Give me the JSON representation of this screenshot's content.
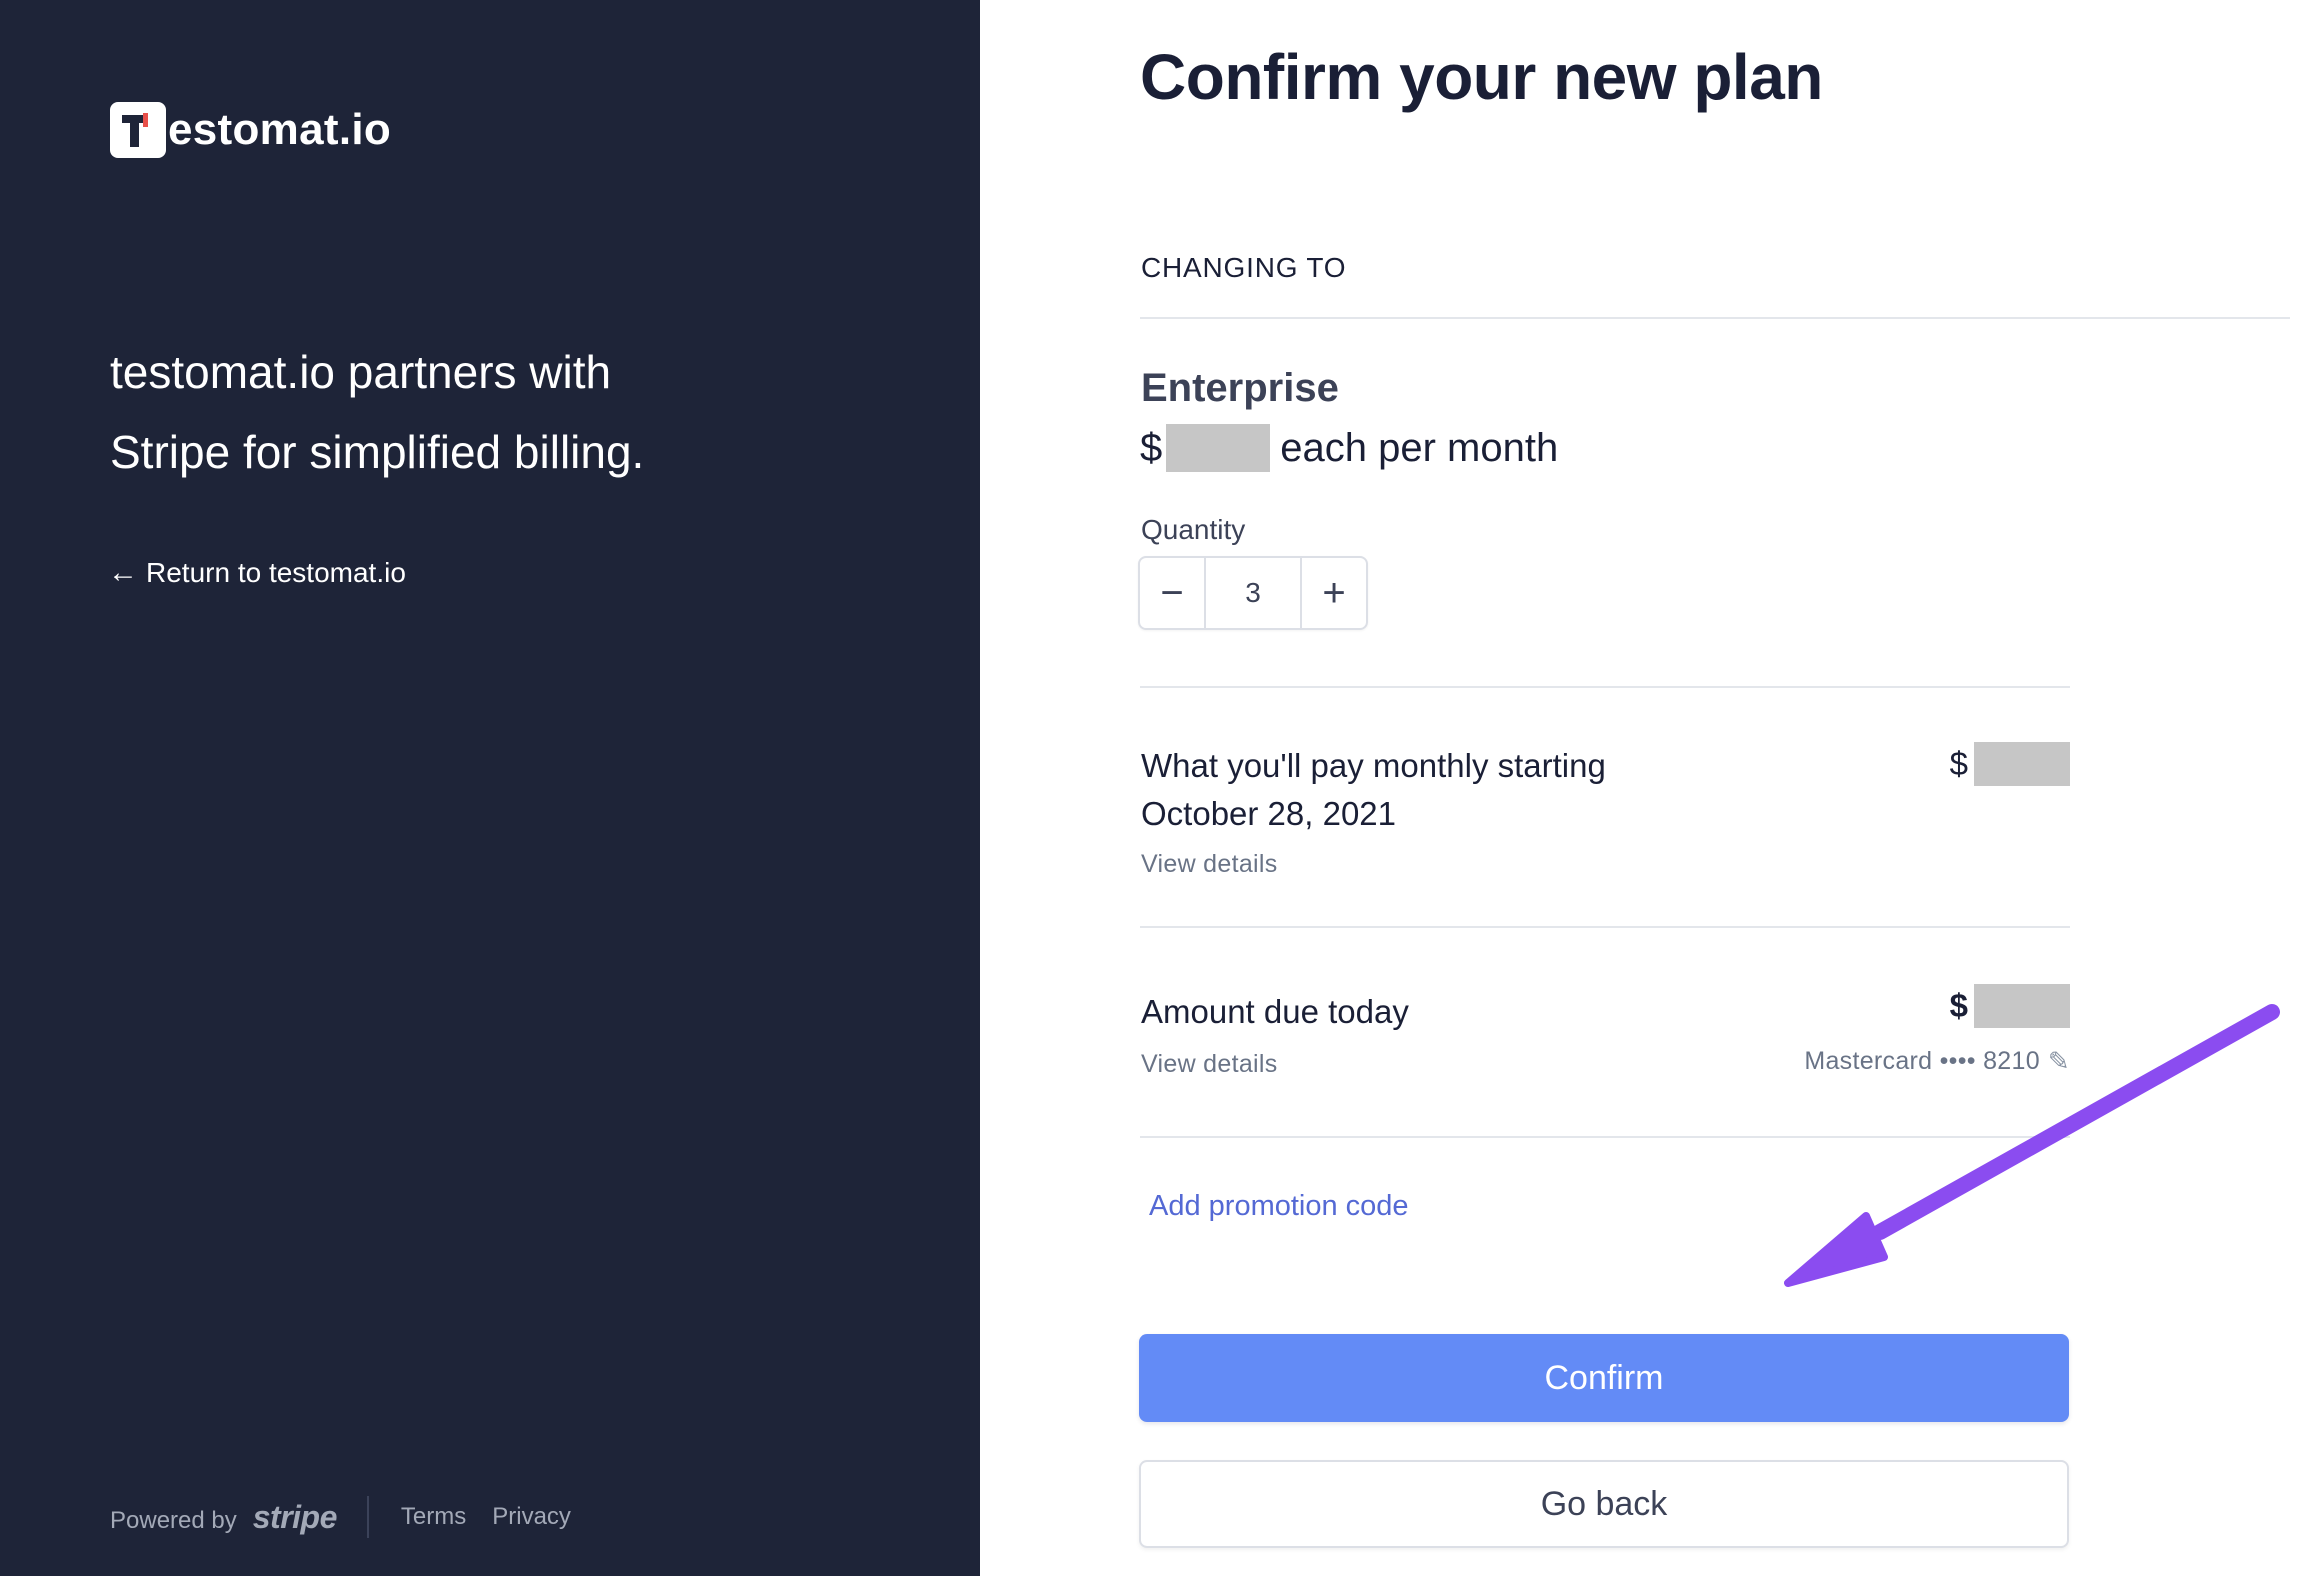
{
  "brand": {
    "logo_text": "estomat.io",
    "tagline_line1": "testomat.io partners with",
    "tagline_line2": "Stripe for simplified billing.",
    "return_link": "Return to testomat.io"
  },
  "footer": {
    "powered_by": "Powered by",
    "stripe": "stripe",
    "terms": "Terms",
    "privacy": "Privacy"
  },
  "main": {
    "title": "Confirm your new plan",
    "changing_to": "CHANGING TO",
    "plan_name": "Enterprise",
    "price_prefix": "$",
    "price_suffix": "each per month",
    "quantity_label": "Quantity",
    "quantity_value": "3",
    "monthly_label_line1": "What you'll pay monthly starting",
    "monthly_label_line2": "October 28, 2021",
    "monthly_view_details": "View details",
    "monthly_currency": "$",
    "due_label": "Amount due today",
    "due_view_details": "View details",
    "due_currency": "$",
    "card": "Mastercard •••• 8210",
    "promo": "Add promotion code",
    "confirm": "Confirm",
    "go_back": "Go back"
  },
  "colors": {
    "left_panel_bg": "#1e2438",
    "confirm_bg": "#638bf6",
    "link": "#5469d4",
    "annotation_arrow": "#8b4cf0"
  }
}
